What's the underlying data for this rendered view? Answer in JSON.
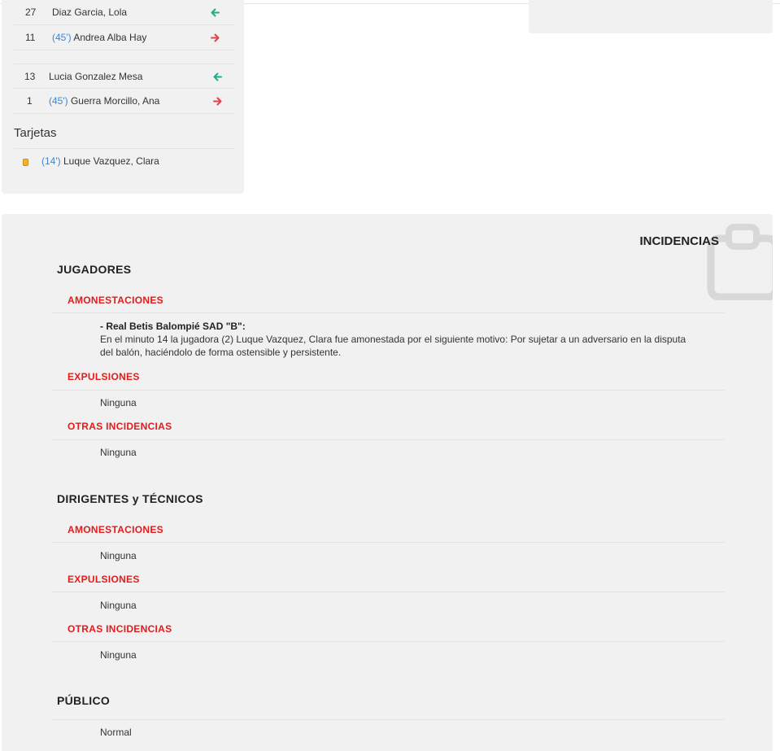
{
  "substitutions": [
    {
      "number": "27",
      "minute": "",
      "name": "Diaz Garcia, Lola",
      "direction": "in",
      "icon": "arrow-left-icon"
    },
    {
      "number": "11",
      "minute": "(45')",
      "name": " Andrea Alba Hay",
      "direction": "out",
      "icon": "arrow-right-icon"
    },
    {
      "number": "13",
      "minute": "",
      "name": "Lucia Gonzalez Mesa",
      "direction": "in",
      "icon": "arrow-left-icon"
    },
    {
      "number": "1",
      "minute": "(45')",
      "name": " Guerra Morcillo, Ana",
      "direction": "out",
      "icon": "arrow-right-icon"
    }
  ],
  "cards": {
    "title": "Tarjetas",
    "items": [
      {
        "minute": "(14')",
        "name": " Luque Vazquez, Clara",
        "type": "yellow",
        "icon": "yellow-card-icon"
      }
    ]
  },
  "incidencias": {
    "title": "INCIDENCIAS",
    "icon": "clipboard-icon",
    "jugadores": {
      "title": "JUGADORES",
      "amonestaciones_label": "AMONESTACIONES",
      "amonestaciones_team": "- Real Betis Balompié SAD \"B\":",
      "amonestaciones_text": "En el minuto 14 la jugadora (2) Luque Vazquez, Clara fue amonestada por el siguiente motivo: Por sujetar a un adversario en la disputa del balón, haciéndolo de forma ostensible y persistente.",
      "expulsiones_label": "EXPULSIONES",
      "expulsiones_value": "Ninguna",
      "otras_label": "OTRAS INCIDENCIAS",
      "otras_value": "Ninguna"
    },
    "dirigentes": {
      "title": "DIRIGENTES y TÉCNICOS",
      "amonestaciones_label": "AMONESTACIONES",
      "amonestaciones_value": "Ninguna",
      "expulsiones_label": "EXPULSIONES",
      "expulsiones_value": "Ninguna",
      "otras_label": "OTRAS INCIDENCIAS",
      "otras_value": "Ninguna"
    },
    "publico": {
      "title": "PÚBLICO",
      "value": "Normal"
    }
  },
  "colors": {
    "arrow_in": "#26a98a",
    "arrow_out": "#e0444e",
    "minute": "#3a87d6",
    "section_red": "#e41b1b",
    "panel_bg": "#f1f1f1"
  }
}
